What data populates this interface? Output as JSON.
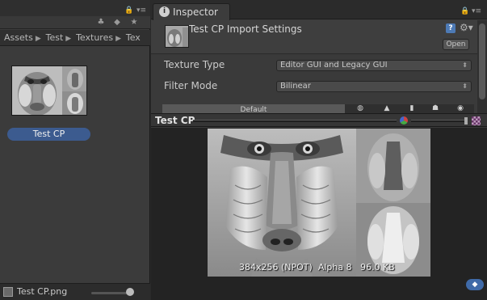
{
  "project": {
    "breadcrumb": [
      "Assets",
      "Test",
      "Textures",
      "Tex"
    ],
    "asset_label": "Test CP",
    "footer_file": "Test CP.png",
    "icons": {
      "lock": "lock-icon",
      "menu": "menu-icon",
      "filter_type": "shapes-icon",
      "filter_label": "tag-icon",
      "favorites": "star-icon"
    }
  },
  "inspector": {
    "tab_label": "Inspector",
    "title": "Test CP Import Settings",
    "open_label": "Open",
    "fields": [
      {
        "label": "Texture Type",
        "value": "Editor GUI and Legacy GUI"
      },
      {
        "label": "Filter Mode",
        "value": "Bilinear"
      }
    ],
    "platform_default": "Default",
    "icons": {
      "info": "info-icon",
      "help": "help-icon",
      "settings": "gear-icon"
    }
  },
  "preview": {
    "title": "Test CP",
    "info": "384x256 (NPOT)  Alpha 8   96.0 KB"
  }
}
